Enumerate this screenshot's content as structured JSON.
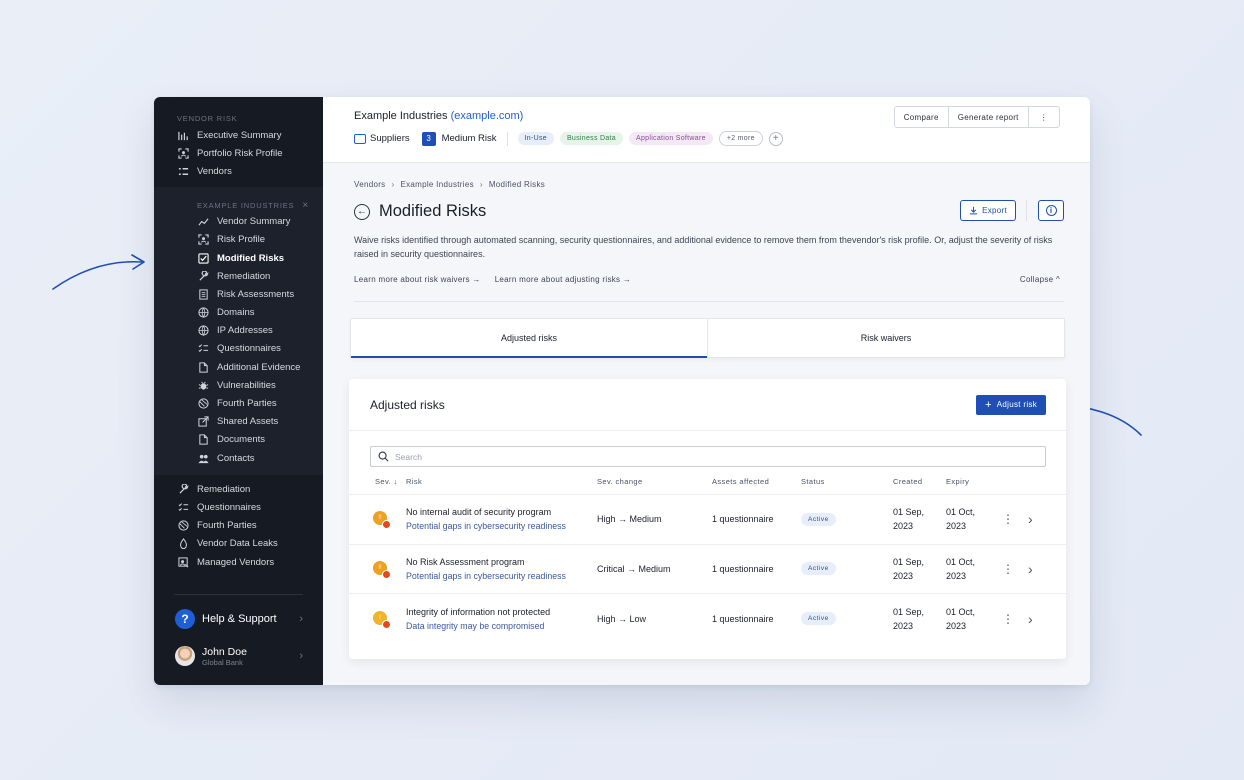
{
  "sidebar": {
    "section_label": "VENDOR RISK",
    "top_items": [
      {
        "label": "Executive Summary",
        "icon": "bar-chart-icon"
      },
      {
        "label": "Portfolio Risk Profile",
        "icon": "scan-icon"
      },
      {
        "label": "Vendors",
        "icon": "list-icon"
      }
    ],
    "sub_section_label": "EXAMPLE INDUSTRIES",
    "sub_close": "×",
    "sub_items": [
      {
        "label": "Vendor Summary",
        "icon": "trend-icon"
      },
      {
        "label": "Risk Profile",
        "icon": "scan-icon"
      },
      {
        "label": "Modified Risks",
        "icon": "checkbox-icon",
        "active": true
      },
      {
        "label": "Remediation",
        "icon": "wrench-icon"
      },
      {
        "label": "Risk Assessments",
        "icon": "doc-list-icon"
      },
      {
        "label": "Domains",
        "icon": "globe-icon"
      },
      {
        "label": "IP Addresses",
        "icon": "globe-icon"
      },
      {
        "label": "Questionnaires",
        "icon": "checklist-icon"
      },
      {
        "label": "Additional Evidence",
        "icon": "file-icon"
      },
      {
        "label": "Vulnerabilities",
        "icon": "bug-icon"
      },
      {
        "label": "Fourth Parties",
        "icon": "network-icon"
      },
      {
        "label": "Shared Assets",
        "icon": "share-icon"
      },
      {
        "label": "Documents",
        "icon": "file-icon"
      },
      {
        "label": "Contacts",
        "icon": "people-icon"
      }
    ],
    "lower_items": [
      {
        "label": "Remediation",
        "icon": "wrench-icon"
      },
      {
        "label": "Questionnaires",
        "icon": "checklist-icon"
      },
      {
        "label": "Fourth Parties",
        "icon": "network-icon"
      },
      {
        "label": "Vendor Data Leaks",
        "icon": "drop-icon"
      },
      {
        "label": "Managed Vendors",
        "icon": "managed-icon"
      }
    ],
    "help_label": "Help & Support",
    "help_icon": "?",
    "user_name": "John Doe",
    "user_org": "Global Bank",
    "chevron": "›"
  },
  "topbar": {
    "company": "Example Industries",
    "domain": "(example.com)",
    "folder_label": "Suppliers",
    "risk_count": "3",
    "risk_label": "Medium Risk",
    "pills": [
      "In-Use",
      "Business Data",
      "Application Software",
      "+2 more"
    ],
    "plus": "+",
    "compare": "Compare",
    "generate": "Generate report",
    "more": "⋮"
  },
  "page": {
    "breadcrumb": [
      "Vendors",
      "Example Industries",
      "Modified Risks"
    ],
    "breadcrumb_sep": "›",
    "back_icon": "←",
    "title": "Modified Risks",
    "export_label": "Export",
    "info_label": "i",
    "description": "Waive risks identified through automated scanning, security questionnaires, and additional evidence to remove them from thevendor's risk profile. Or, adjust the severity of risks raised in security questionnaires.",
    "learn_waivers": "Learn more about risk waivers →",
    "learn_adjusting": "Learn more about adjusting risks →",
    "collapse": "Collapse ^"
  },
  "tabs": {
    "adjusted": "Adjusted risks",
    "waivers": "Risk waivers"
  },
  "panel": {
    "title": "Adjusted risks",
    "adjust_label": "Adjust risk",
    "adjust_plus": "+",
    "search_placeholder": "Search",
    "headers": {
      "sev": "Sev. ↓",
      "risk": "Risk",
      "change": "Sev. change",
      "assets": "Assets affected",
      "status": "Status",
      "created": "Created",
      "expiry": "Expiry"
    },
    "rows": [
      {
        "sev_glyph": "!!",
        "title": "No internal audit of security program",
        "subtitle": "Potential gaps in cybersecurity readiness",
        "change": "High → Medium",
        "assets": "1 questionnaire",
        "status": "Active",
        "created_1": "01 Sep,",
        "created_2": "2023",
        "expiry_1": "01 Oct,",
        "expiry_2": "2023"
      },
      {
        "sev_glyph": "!!",
        "title": "No Risk Assessment program",
        "subtitle": "Potential gaps in cybersecurity readiness",
        "change": "Critical → Medium",
        "assets": "1 questionnaire",
        "status": "Active",
        "created_1": "01 Sep,",
        "created_2": "2023",
        "expiry_1": "01 Oct,",
        "expiry_2": "2023"
      },
      {
        "sev_glyph": "!",
        "title": "Integrity of information not protected",
        "subtitle": "Data integrity may be compromised",
        "change": "High → Low",
        "assets": "1 questionnaire",
        "status": "Active",
        "created_1": "01 Sep,",
        "created_2": "2023",
        "expiry_1": "01 Oct,",
        "expiry_2": "2023"
      }
    ],
    "row_more": "⋮",
    "row_chevron": "›"
  },
  "colors": {
    "sidebar_bg": "#161a22",
    "accent": "#1f4fb4",
    "sev_orange": "#f0a020",
    "sev_red": "#e14a1c"
  }
}
